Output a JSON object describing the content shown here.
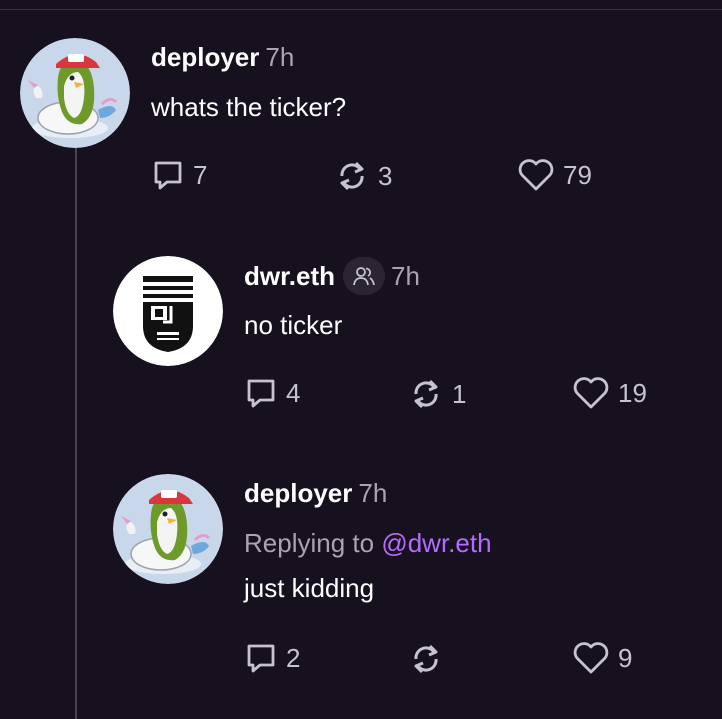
{
  "posts": [
    {
      "username": "deployer",
      "time": "7h",
      "text": "whats the ticker?",
      "replies": "7",
      "recasts": "3",
      "likes": "79"
    },
    {
      "username": "dwr.eth",
      "time": "7h",
      "badge_icon": "power-badge-icon",
      "text": "no ticker",
      "replies": "4",
      "recasts": "1",
      "likes": "19"
    },
    {
      "username": "deployer",
      "time": "7h",
      "replying_prefix": "Replying to",
      "replying_to": "@dwr.eth",
      "text": "just kidding",
      "replies": "2",
      "recasts": "",
      "likes": "9"
    }
  ],
  "colors": {
    "background": "#17101f",
    "mention": "#b56bff",
    "muted": "#a9a3b2"
  }
}
